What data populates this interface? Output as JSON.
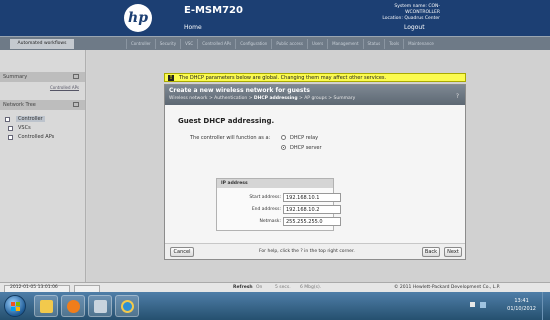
{
  "header": {
    "model": "E-MSM720",
    "home": "Home",
    "logout": "Logout",
    "system_name": "System name: CON-WCONTROLLER",
    "location": "Location: Quadrus Center"
  },
  "nav": {
    "left_tab": "Automated workflows",
    "tabs": [
      "Controller",
      "Security",
      "VSC",
      "Controlled APs",
      "Configuration",
      "Public access",
      "Users",
      "Management",
      "Status",
      "Tools",
      "Maintenance"
    ]
  },
  "sidebar": {
    "summary_title": "Summary",
    "summary_link": "Controlled APs",
    "tree_title": "Network Tree",
    "tree_items": [
      "Controller",
      "VSCs",
      "Controlled APs"
    ]
  },
  "notice": "The DHCP parameters below are global. Changing them may affect other services.",
  "wizard": {
    "title": "Create a new wireless network for guests",
    "crumb_prefix": "Wireless network > Authentication > ",
    "crumb_current": "DHCP addressing",
    "crumb_suffix": " > AP groups > Summary",
    "help_icon": "?",
    "section_title": "Guest DHCP addressing.",
    "mode_label": "The controller will function as a:",
    "options": [
      "DHCP relay",
      "DHCP server"
    ],
    "selected_option": "DHCP server",
    "ip_title": "IP address",
    "fields": [
      {
        "label": "Start address:",
        "value": "192.168.10.1"
      },
      {
        "label": "End address:",
        "value": "192.168.10.2"
      },
      {
        "label": "Netmask:",
        "value": "255.255.255.0"
      }
    ],
    "cancel": "Cancel",
    "help_text": "For help, click the ? in the top right corner.",
    "back": "Back",
    "next": "Next"
  },
  "status": {
    "datetime": "2012-01-05 13:01:06",
    "refresh_label": "Refresh",
    "refresh_on": "On",
    "refresh_interval": "5 secs.",
    "refresh_mbps": "6 Mbg(s).",
    "copyright": "© 2011 Hewlett-Packard Development Co., L.P."
  },
  "taskbar": {
    "time": "13:41",
    "date": "01/10/2012"
  },
  "colors": {
    "header_bg": "#1c3f73",
    "notice_bg": "#fbfb4f",
    "taskbar_bg": "#25506f"
  }
}
